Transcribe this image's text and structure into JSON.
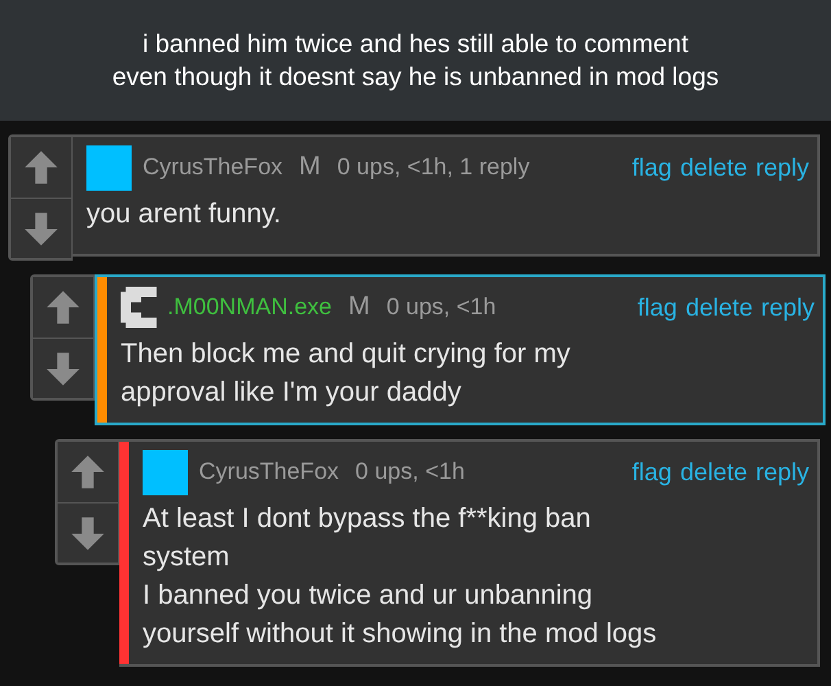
{
  "caption": "i banned him twice and hes still able to comment\neven though it doesnt say he is unbanned in mod logs",
  "comments": [
    {
      "avatar": {
        "kind": "square"
      },
      "user": {
        "name": "CyrusTheFox",
        "color": "#9a9a9a"
      },
      "mod_badge": "M",
      "meta": "0 ups, <1h, 1 reply",
      "actions": [
        "flag",
        "delete",
        "reply"
      ],
      "text": "you arent funny.",
      "highlighted": false,
      "children": [
        {
          "avatar": {
            "kind": "pixel"
          },
          "user": {
            "name": ".M00NMAN.exe",
            "color": "#3fbf3f"
          },
          "mod_badge": "M",
          "meta": "0 ups, <1h",
          "actions": [
            "flag",
            "delete",
            "reply"
          ],
          "text": "Then block me and quit crying for my\napproval like I'm your daddy",
          "highlighted": true,
          "stripe": {
            "color": "#ff8c00"
          },
          "children": [
            {
              "avatar": {
                "kind": "square"
              },
              "user": {
                "name": "CyrusTheFox",
                "color": "#9a9a9a"
              },
              "meta": "0 ups, <1h",
              "actions": [
                "flag",
                "delete",
                "reply"
              ],
              "text": "At least I dont bypass the f**king ban\nsystem\nI banned you twice and ur unbanning\nyourself without it showing in the mod logs",
              "highlighted": false,
              "stripe": {
                "color": "#ff3333"
              }
            }
          ]
        }
      ]
    }
  ]
}
